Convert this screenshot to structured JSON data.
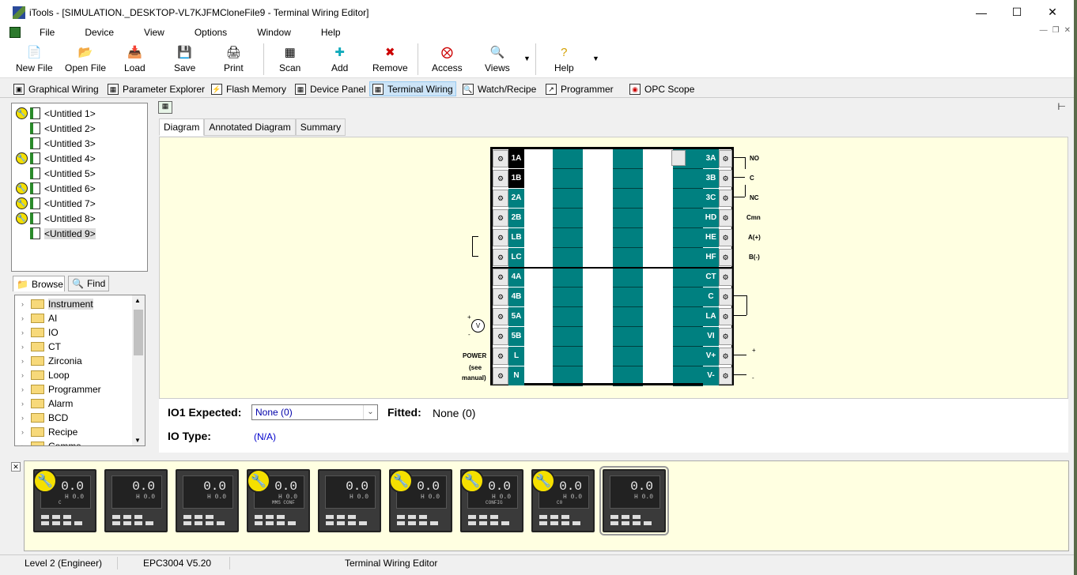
{
  "titlebar": {
    "title": "iTools - [SIMULATION._DESKTOP-VL7KJFMCloneFile9 - Terminal Wiring Editor]",
    "min": "—",
    "max": "☐",
    "close": "✕"
  },
  "menu": [
    "File",
    "Device",
    "View",
    "Options",
    "Window",
    "Help"
  ],
  "toolbar": {
    "new_file": "New File",
    "open_file": "Open File",
    "load": "Load",
    "save": "Save",
    "print": "Print",
    "scan": "Scan",
    "add": "Add",
    "remove": "Remove",
    "access": "Access",
    "views": "Views",
    "help": "Help"
  },
  "viewbar": {
    "graphical_wiring": "Graphical Wiring",
    "parameter_explorer": "Parameter Explorer",
    "flash_memory": "Flash Memory",
    "device_panel": "Device Panel",
    "terminal_wiring": "Terminal Wiring",
    "watch_recipe": "Watch/Recipe",
    "programmer": "Programmer",
    "opc_scope": "OPC Scope"
  },
  "files": [
    "<Untitled 1>",
    "<Untitled 2>",
    "<Untitled 3>",
    "<Untitled 4>",
    "<Untitled 5>",
    "<Untitled 6>",
    "<Untitled 7>",
    "<Untitled 8>",
    "<Untitled 9>"
  ],
  "browse_tabs": {
    "browse": "Browse",
    "find": "Find"
  },
  "tree": [
    "Instrument",
    "AI",
    "IO",
    "CT",
    "Zirconia",
    "Loop",
    "Programmer",
    "Alarm",
    "BCD",
    "Recipe",
    "Comms"
  ],
  "diagram_tabs": {
    "diagram": "Diagram",
    "annotated": "Annotated Diagram",
    "summary": "Summary"
  },
  "terminals_left": [
    "1A",
    "1B",
    "2A",
    "2B",
    "LB",
    "LC",
    "4A",
    "4B",
    "5A",
    "5B",
    "L",
    "N"
  ],
  "terminals_right": [
    "3A",
    "3B",
    "3C",
    "HD",
    "HE",
    "HF",
    "CT",
    "C",
    "LA",
    "VI",
    "V+",
    "V-"
  ],
  "annotations": {
    "no": "NO",
    "c": "C",
    "nc": "NC",
    "cmn": "Cmn",
    "a": "A(+)",
    "b": "B(-)",
    "power": "POWER",
    "see": "(see",
    "manual": "manual)",
    "v": "V",
    "plus": "+",
    "minus": "-"
  },
  "io": {
    "expected_label": "IO1 Expected:",
    "expected_value": "None (0)",
    "fitted_label": "Fitted:",
    "fitted_value": "None (0)",
    "type_label": "IO Type:",
    "type_value": "(N/A)"
  },
  "devices": [
    {
      "num": "0.0",
      "sub": "H 0.0",
      "mode": "C",
      "wrench": true
    },
    {
      "num": "0.0",
      "sub": "H 0.0",
      "mode": "",
      "wrench": false
    },
    {
      "num": "0.0",
      "sub": "H 0.0",
      "mode": "",
      "wrench": false
    },
    {
      "num": "0.0",
      "sub": "H 0.0",
      "mode": "MMS CONF",
      "wrench": true
    },
    {
      "num": "0.0",
      "sub": "H 0.0",
      "mode": "",
      "wrench": false
    },
    {
      "num": "0.0",
      "sub": "H 0.0",
      "mode": "",
      "wrench": true
    },
    {
      "num": "0.0",
      "sub": "H 0.0",
      "mode": "CONFIG",
      "wrench": true
    },
    {
      "num": "0.0",
      "sub": "H 0.0",
      "mode": "C0",
      "wrench": true
    },
    {
      "num": "0.0",
      "sub": "H 0.0",
      "mode": "",
      "wrench": false
    }
  ],
  "status": {
    "level": "Level 2 (Engineer)",
    "device": "EPC3004 V5.20",
    "editor": "Terminal Wiring Editor"
  }
}
